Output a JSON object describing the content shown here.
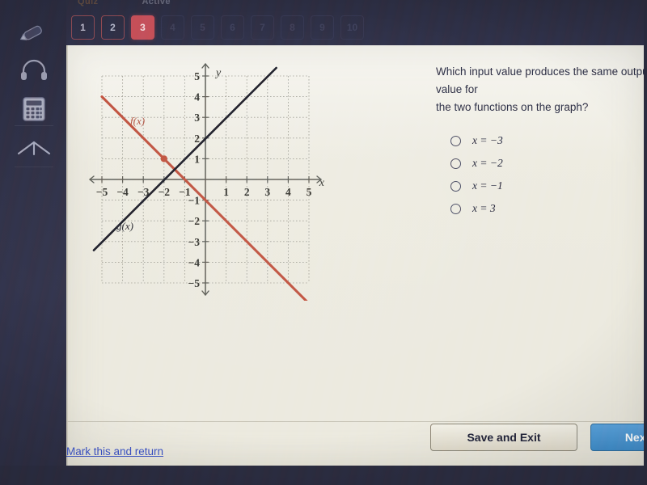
{
  "topbar": {
    "quiz_label": "Quiz",
    "status_label": "Active",
    "question_buttons": [
      {
        "label": "1",
        "state": "answered"
      },
      {
        "label": "2",
        "state": "answered"
      },
      {
        "label": "3",
        "state": "current"
      },
      {
        "label": "4",
        "state": "dim"
      },
      {
        "label": "5",
        "state": "dim"
      },
      {
        "label": "6",
        "state": "dim"
      },
      {
        "label": "7",
        "state": "dim"
      },
      {
        "label": "8",
        "state": "dim"
      },
      {
        "label": "9",
        "state": "dim"
      },
      {
        "label": "10",
        "state": "dim"
      }
    ]
  },
  "rail": {
    "items": [
      {
        "icon": "pencil-icon",
        "name": "highlighter-tool"
      },
      {
        "icon": "headphones-icon",
        "name": "audio-tool"
      },
      {
        "icon": "calculator-icon",
        "name": "calculator-tool"
      },
      {
        "icon": "protractor-icon",
        "name": "protractor-tool"
      }
    ]
  },
  "question": {
    "text": "Which input value produces the same output value for\nthe two functions on the graph?",
    "choices": [
      {
        "label": "x = −3",
        "selected": false
      },
      {
        "label": "x = −2",
        "selected": false
      },
      {
        "label": "x = −1",
        "selected": false
      },
      {
        "label": "x = 3",
        "selected": false
      }
    ]
  },
  "footer": {
    "mark_link": "Mark this and return",
    "save_exit": "Save and Exit",
    "next": "Next"
  },
  "colors": {
    "f_line": "#c0533f",
    "g_line": "#1d1d28",
    "axis": "#5d5d55",
    "grid": "#9d9d92",
    "page_bg": "#eceadf",
    "current_q": "#c44f58",
    "next_btn": "#4a90d0",
    "link": "#3b52c4"
  },
  "chart_data": {
    "type": "line",
    "title": "",
    "xlabel": "x",
    "ylabel": "y",
    "xlim": [
      -5.5,
      5.5
    ],
    "ylim": [
      -5.5,
      5.5
    ],
    "xticks": [
      -5,
      -4,
      -3,
      -2,
      -1,
      1,
      2,
      3,
      4,
      5
    ],
    "yticks": [
      5,
      4,
      3,
      2,
      1,
      -1,
      -2,
      -3,
      -4,
      -5
    ],
    "grid": true,
    "grid_style": "dotted",
    "legend": "inline-labels",
    "series": [
      {
        "name": "f(x)",
        "color": "#c0533f",
        "equation": "f(x) = -x - 1",
        "slope": -1,
        "intercept": -1,
        "label_at": {
          "x": -3.6,
          "y": 2.6
        },
        "points": [
          {
            "x": -5,
            "y": 4
          },
          {
            "x": 5,
            "y": -6
          }
        ]
      },
      {
        "name": "g(x)",
        "color": "#1d1d28",
        "equation": "g(x) = x + 3",
        "slope": 1,
        "intercept": 3,
        "label_at": {
          "x": -4.2,
          "y": -2.2
        },
        "points": [
          {
            "x": -5.4,
            "y": -2.4
          },
          {
            "x": 3.4,
            "y": 6.4
          }
        ]
      }
    ],
    "annotations": [
      {
        "type": "point",
        "label": "intersection",
        "x": -2,
        "y": 1,
        "color": "#c0533f"
      }
    ]
  }
}
